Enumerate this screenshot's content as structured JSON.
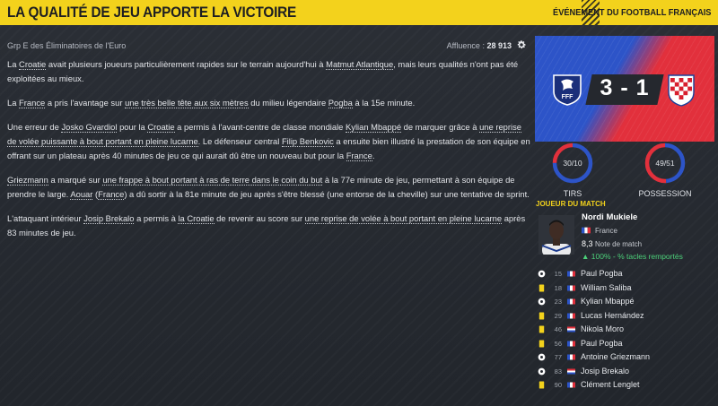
{
  "header": {
    "title": "LA QUALITÉ DE JEU APPORTE LA VICTOIRE",
    "event": "ÉVÉNEMENT DU FOOTBALL FRANÇAIS"
  },
  "meta": {
    "competition": "Grp E des Éliminatoires de l'Euro",
    "attendance_label": "Affluence :",
    "attendance_value": "28 913"
  },
  "article": {
    "p1": {
      "a": "La ",
      "b": "Croatie",
      "c": " avait plusieurs joueurs particulièrement rapides sur le terrain aujourd'hui à ",
      "d": "Matmut Atlantique",
      "e": ", mais leurs qualités n'ont pas été exploitées au mieux."
    },
    "p2": {
      "a": "La ",
      "b": "France",
      "c": " a pris l'avantage sur ",
      "d": "une très belle tête aux six mètres",
      "e": " du milieu légendaire ",
      "f": "Pogba",
      "g": " à la 15e minute."
    },
    "p3": {
      "a": "Une erreur de ",
      "b": "Josko Gvardiol",
      "c": " pour la ",
      "d": "Croatie",
      "e": " a permis à l'avant-centre de classe mondiale ",
      "f": "Kylian Mbappé",
      "g": " de marquer grâce à ",
      "h": "une reprise de volée puissante à bout portant en pleine lucarne",
      "i": ". Le défenseur central ",
      "j": "Filip Benkovic",
      "k": " a ensuite bien illustré la prestation de son équipe en offrant sur un plateau après 40 minutes de jeu ce qui aurait dû être un nouveau but pour la ",
      "l": "France",
      "m": "."
    },
    "p4": {
      "a": "Griezmann",
      "b": " a marqué sur ",
      "c": "une frappe à bout portant à ras de terre dans le coin du but",
      "d": " à la 77e minute de jeu, permettant à son équipe de prendre le large. ",
      "e": "Aouar",
      "f": " (",
      "g": "France",
      "h": ") a dû sortir à la 81e minute de jeu après s'être blessé (une entorse de la cheville) sur une tentative de sprint."
    },
    "p5": {
      "a": "L'attaquant intérieur ",
      "b": "Josip Brekalo",
      "c": " a permis à ",
      "d": "la Croatie",
      "e": " de revenir au score sur ",
      "f": "une reprise de volée à bout portant en pleine lucarne",
      "g": " après 83 minutes de jeu."
    }
  },
  "score": {
    "home_team_logo": "fff-crest-icon",
    "away_team_logo": "croatia-crest-icon",
    "home": 3,
    "away": 1,
    "display": "3 - 1",
    "colors": {
      "home": "#2d54c8",
      "away": "#e2303c",
      "panel": "#25282e"
    }
  },
  "stats": {
    "shots": {
      "label": "TIRS",
      "home": 30,
      "away": 10,
      "display": "30/10"
    },
    "possession": {
      "label": "POSSESSION",
      "home": 49,
      "away": 51,
      "display": "49/51"
    }
  },
  "man_of_match": {
    "title": "JOUEUR DU MATCH",
    "name": "Nordi Mukiele",
    "country": "France",
    "rating": "8,3",
    "rating_label": "Note de match",
    "stat": "100% - % tacles remportés"
  },
  "events": [
    {
      "icon": "goal-ball-icon",
      "minute": "15",
      "team": "france",
      "player": "Paul Pogba"
    },
    {
      "icon": "yellow-card-icon",
      "minute": "18",
      "team": "france",
      "player": "William Saliba"
    },
    {
      "icon": "goal-ball-icon",
      "minute": "23",
      "team": "france",
      "player": "Kylian Mbappé"
    },
    {
      "icon": "yellow-card-icon",
      "minute": "29",
      "team": "france",
      "player": "Lucas Hernández"
    },
    {
      "icon": "yellow-card-icon",
      "minute": "46",
      "team": "croatia",
      "player": "Nikola Moro"
    },
    {
      "icon": "yellow-card-icon",
      "minute": "56",
      "team": "france",
      "player": "Paul Pogba"
    },
    {
      "icon": "goal-ball-icon",
      "minute": "77",
      "team": "france",
      "player": "Antoine Griezmann"
    },
    {
      "icon": "goal-ball-icon",
      "minute": "83",
      "team": "croatia",
      "player": "Josip Brekalo"
    },
    {
      "icon": "yellow-card-icon",
      "minute": "90",
      "team": "france",
      "player": "Clément Lenglet"
    }
  ]
}
